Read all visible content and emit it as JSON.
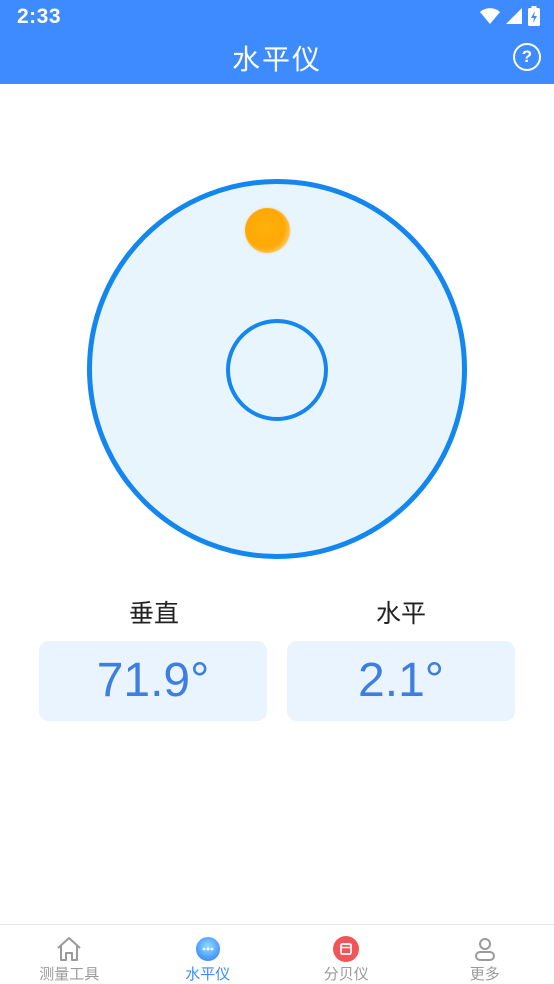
{
  "status_bar": {
    "time": "2:33"
  },
  "header": {
    "title": "水平仪",
    "help_glyph": "?"
  },
  "level": {
    "bubble_color": "#ffa805",
    "ring_color": "#1486ef"
  },
  "readings": [
    {
      "label": "垂直",
      "value": "71.9°"
    },
    {
      "label": "水平",
      "value": "2.1°"
    }
  ],
  "tabs": [
    {
      "label": "测量工具",
      "icon": "home-icon",
      "active": false
    },
    {
      "label": "水平仪",
      "icon": "level-icon",
      "active": true
    },
    {
      "label": "分贝仪",
      "icon": "decibel-icon",
      "active": false
    },
    {
      "label": "更多",
      "icon": "person-icon",
      "active": false
    }
  ],
  "colors": {
    "accent": "#3d8bff",
    "value_text": "#3d7fe0",
    "value_bg": "#e9f4fe",
    "decibel": "#f0555a"
  }
}
